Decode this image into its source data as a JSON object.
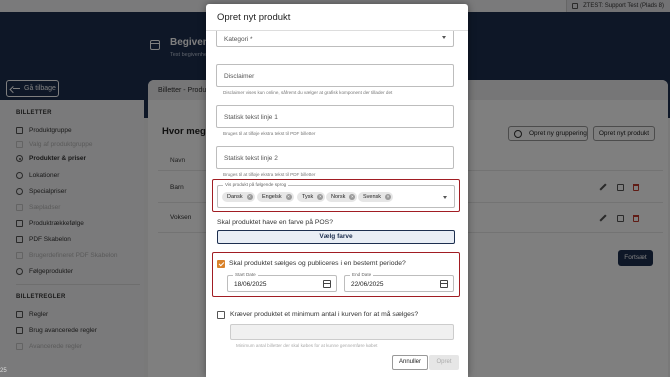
{
  "topbar": {
    "user_label": "ZTEST: Support Test (Plads 8)"
  },
  "hero": {
    "title": "Begivenh",
    "subtitle": "Test begivenhe"
  },
  "back_button": "Gå tilbage",
  "sidebar": {
    "section1_title": "BILLETTER",
    "items": [
      {
        "label": "Produktgruppe",
        "dim": false
      },
      {
        "label": "Valg af produktgruppe",
        "dim": true
      },
      {
        "label": "Produkter & priser",
        "dim": false,
        "active": true
      },
      {
        "label": "Lokationer",
        "dim": false
      },
      {
        "label": "Specialpriser",
        "dim": false
      },
      {
        "label": "Sæpladser",
        "dim": true
      },
      {
        "label": "Produktrækkefølge",
        "dim": false
      },
      {
        "label": "PDF Skabelon",
        "dim": false
      },
      {
        "label": "Brugerdefineret PDF Skabelon",
        "dim": true
      },
      {
        "label": "Følgeprodukter",
        "dim": false
      }
    ],
    "section2_title": "BILLETREGLER",
    "rules": [
      {
        "label": "Regler",
        "dim": false
      },
      {
        "label": "Brug avancerede regler",
        "dim": false
      },
      {
        "label": "Avancerede regler",
        "dim": true
      }
    ]
  },
  "main": {
    "breadcrumb": "Billetter - Produ",
    "question": "Hvor meget",
    "btn_group": "Opret ny gruppering",
    "btn_product": "Opret nyt produkt",
    "col_name": "Navn",
    "rows": [
      "Barn",
      "Voksen"
    ],
    "continue": "Fortsæt"
  },
  "corner_text": "25",
  "modal": {
    "title": "Opret nyt produkt",
    "category_value": "Kategori *",
    "disclaimer_value": "Disclaimer",
    "disclaimer_helper": "Disclaimer vises kun online, såfremt du vælger at grafisk komponent der tillader det",
    "static1_value": "Statisk tekst linje 1",
    "static1_helper": "Bruges til at tilføje ekstra tekst til PDF billetter",
    "static2_value": "Statisk tekst linje 2",
    "static2_helper": "Bruges til at tilføje ekstra tekst til PDF billetter",
    "languages_label": "Vis produkt på følgende sprog",
    "languages": [
      "Dansk",
      "Engelsk",
      "Tysk",
      "Norsk",
      "Svensk"
    ],
    "color_question": "Skal produktet have en farve på POS?",
    "color_button": "Vælg farve",
    "period_question": "Skal produktet sælges og publiceres i en bestemt periode?",
    "start_label": "Start Date",
    "start_value": "18/06/2025",
    "end_label": "End Date",
    "end_value": "22/06/2025",
    "min_question": "Kræver produktet et minimum antal i kurven for at må sælges?",
    "min_helper": "Minimum antal billetter der skal købes for at kunne gennemføre købet",
    "cancel": "Annuller",
    "create": "Opret"
  },
  "colors": {
    "navy": "#1d2f4f",
    "highlight": "#a11d23",
    "checkbox": "#d9822b",
    "delete": "#c0392b"
  }
}
